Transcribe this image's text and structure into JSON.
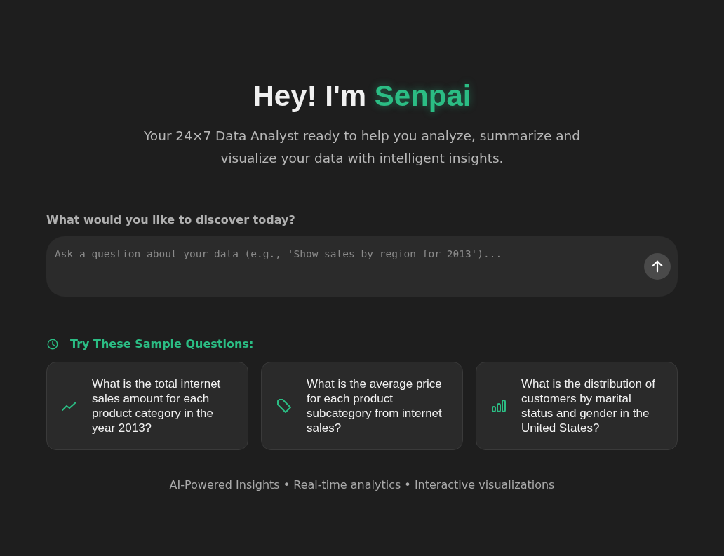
{
  "header": {
    "title_lead": "Hey! I'm",
    "title_name": "Senpai",
    "subtitle": "Your 24×7 Data Analyst ready to help you analyze, summarize and visualize your data with intelligent insights."
  },
  "query": {
    "label": "What would you like to discover today?",
    "placeholder": "Ask a question about your data (e.g., 'Show sales by region for 2013')..."
  },
  "samples": {
    "title": "Try These Sample Questions:",
    "cards": [
      {
        "kind": "trend",
        "text": "What is the total internet sales amount for each product category in the year 2013?"
      },
      {
        "kind": "tag",
        "text": "What is the average price for each product subcategory from internet sales?"
      },
      {
        "kind": "bars",
        "text": "What is the distribution of customers by marital status and gender in the United States?"
      }
    ]
  },
  "footer": "AI-Powered Insights • Real-time analytics • Interactive visualizations"
}
